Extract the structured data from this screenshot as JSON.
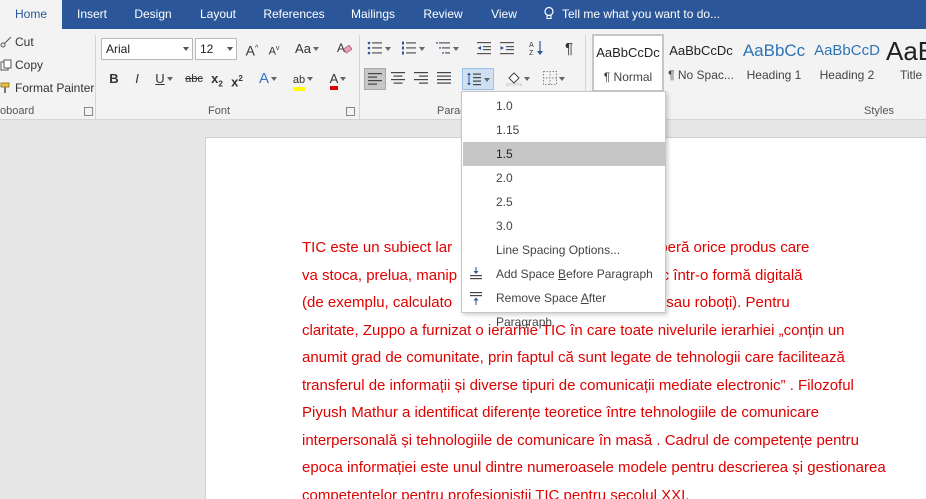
{
  "tabs": [
    {
      "label": "Home",
      "active": true
    },
    {
      "label": "Insert"
    },
    {
      "label": "Design"
    },
    {
      "label": "Layout"
    },
    {
      "label": "References"
    },
    {
      "label": "Mailings"
    },
    {
      "label": "Review"
    },
    {
      "label": "View"
    }
  ],
  "tell_me": "Tell me what you want to do...",
  "clipboard": {
    "cut": "Cut",
    "copy": "Copy",
    "format_painter": "Format Painter",
    "label": "oboard"
  },
  "font": {
    "name": "Arial",
    "size": "12",
    "label": "Font",
    "grow_glyph": "A",
    "shrink_glyph": "A",
    "case_glyph": "Aa",
    "bold": "B",
    "italic": "I",
    "underline": "U",
    "strike": "abc",
    "subscript": "x",
    "superscript": "x",
    "effects_glyph": "A",
    "highlight_glyph": "ab",
    "color_glyph": "A",
    "highlight_color": "#ffff00",
    "font_color": "#e00000"
  },
  "paragraph": {
    "label": "Paragraph",
    "label_visible": "Parag",
    "pilcrow": "¶"
  },
  "styles": {
    "label": "Styles",
    "items": [
      {
        "preview": "AaBbCcDc",
        "name": "¶ Normal",
        "selected": true
      },
      {
        "preview": "AaBbCcDc",
        "name": "¶ No Spac..."
      },
      {
        "preview": "AaBbCc",
        "name": "Heading 1"
      },
      {
        "preview": "AaBbCcD",
        "name": "Heading 2"
      },
      {
        "preview": "AaB",
        "name": "Title"
      }
    ]
  },
  "line_spacing_menu": {
    "items": [
      "1.0",
      "1.15",
      "1.5",
      "2.0",
      "2.5",
      "3.0"
    ],
    "selected": "1.5",
    "options": "Line Spacing Options...",
    "add_space_pre": "Add Space ",
    "add_space_key": "B",
    "add_space_post": "efore Paragraph",
    "remove_space_pre": "Remove Space ",
    "remove_space_key": "A",
    "remove_space_post": "fter Paragraph"
  },
  "document": {
    "text_color": "#e00000",
    "lines": [
      {
        "left": "TIC este un subiect lar",
        "right": "Acesta acoperă orice produs care"
      },
      {
        "left": "va stoca, prelua, manip",
        "right": "rmații electronic într-o formă digitală"
      },
      {
        "left": "(de exemplu, calculato",
        "right": "gitală, e-mail sau roboți). Pentru"
      },
      {
        "left": "claritate, Zuppo a furnizat o ierarhie TIC în care toate nivelurile ierarhiei „conțin un",
        "right": ""
      },
      {
        "left": "anumit grad de comunitate, prin faptul că sunt legate de tehnologii care facilitează",
        "right": ""
      },
      {
        "left": "transferul de informații și diverse tipuri de comunicații mediate electronic” . Filozoful",
        "right": ""
      },
      {
        "left": "Piyush Mathur a identificat diferențe teoretice între tehnologiile de comunicare",
        "right": ""
      },
      {
        "left": "interpersonală și tehnologiile de comunicare în masă . Cadrul de competențe pentru",
        "right": ""
      },
      {
        "left": "epoca informației este unul dintre numeroasele modele pentru descrierea și gestionarea",
        "right": ""
      },
      {
        "left": "competențelor pentru profesioniștii TIC pentru secolul XXI.",
        "right": ""
      }
    ]
  },
  "colors": {
    "ribbon_blue": "#2b579a",
    "menu_highlight": "#c6c6c6"
  }
}
